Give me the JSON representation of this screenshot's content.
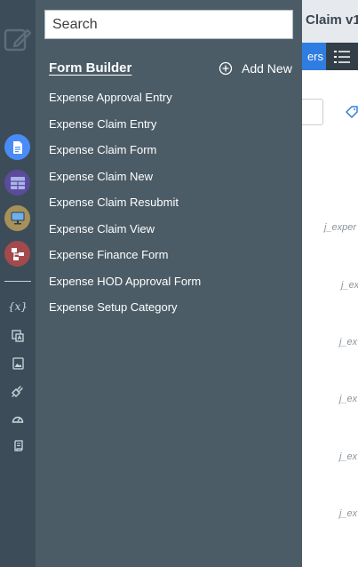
{
  "search": {
    "placeholder": "Search"
  },
  "panel": {
    "section_title": "Form Builder",
    "add_new_label": "Add New",
    "forms": [
      "Expense Approval Entry",
      "Expense Claim Entry",
      "Expense Claim Form",
      "Expense Claim New",
      "Expense Claim Resubmit",
      "Expense Claim View",
      "Expense Finance Form",
      "Expense HOD Approval Form",
      "Expense Setup Category"
    ]
  },
  "rail": {
    "fx_label": "{x}",
    "circle_icons": [
      {
        "name": "document-icon",
        "color": "#4a8cf7"
      },
      {
        "name": "grid-icon",
        "color": "#5b4b9b"
      },
      {
        "name": "monitor-icon",
        "color": "#a6915a"
      },
      {
        "name": "hierarchy-icon",
        "color": "#a34a4d"
      }
    ],
    "tool_icons": [
      "variables-icon",
      "translate-icon",
      "image-icon",
      "plugin-icon",
      "dashboard-icon",
      "script-icon"
    ]
  },
  "background": {
    "title": "Claim v1",
    "tab_label": "ers",
    "fields": [
      "j_exper",
      "j_ex",
      "j_ex",
      "j_ex",
      "j_ex",
      "j_ex"
    ]
  },
  "colors": {
    "rail_bg": "#3c4d59",
    "panel_bg": "#4b5c66",
    "accent_blue": "#2f7de1"
  }
}
